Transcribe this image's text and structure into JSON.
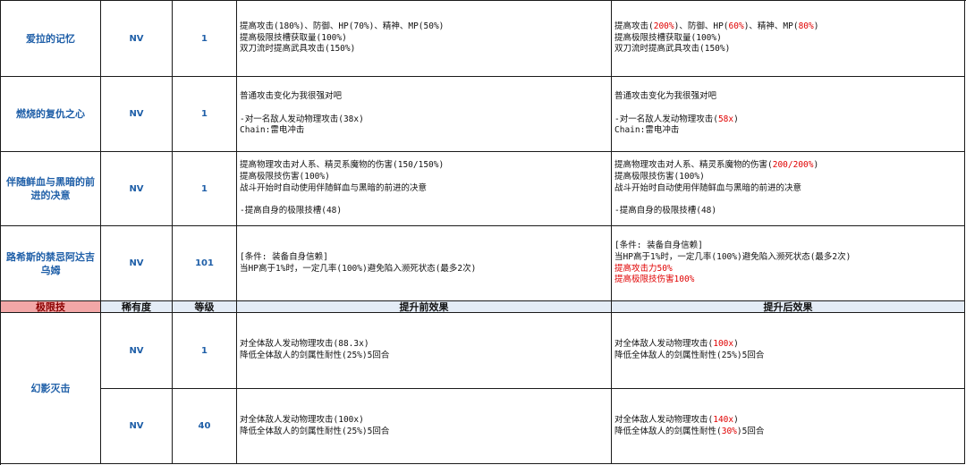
{
  "colors": {
    "name_text": "#1f5fa8",
    "highlight": "#e00000",
    "header_bg": "#e4ecf6",
    "header_first_bg": "#f2a7a7",
    "header_first_text": "#8b0000"
  },
  "header": {
    "name": "极限技",
    "rarity": "稀有度",
    "level": "等级",
    "before": "提升前效果",
    "after": "提升后效果"
  },
  "passives": [
    {
      "name": "爱拉的记忆",
      "rarity": "NV",
      "level": "1",
      "before": [
        [
          {
            "t": "提高攻击(180%)、防御、HP(70%)、精神、MP(50%)"
          }
        ],
        [
          {
            "t": "提高极限技槽获取量(100%)"
          }
        ],
        [
          {
            "t": "双刀流时提高武具攻击(150%)"
          }
        ]
      ],
      "after": [
        [
          {
            "t": "提高攻击("
          },
          {
            "t": "200%",
            "h": true
          },
          {
            "t": ")、防御、HP("
          },
          {
            "t": "60%",
            "h": true
          },
          {
            "t": ")、精神、MP("
          },
          {
            "t": "80%",
            "h": true
          },
          {
            "t": ")"
          }
        ],
        [
          {
            "t": "提高极限技槽获取量(100%)"
          }
        ],
        [
          {
            "t": "双刀流时提高武具攻击(150%)"
          }
        ]
      ]
    },
    {
      "name": "燃烧的复仇之心",
      "rarity": "NV",
      "level": "1",
      "before": [
        [
          {
            "t": "普通攻击变化为我很强对吧"
          }
        ],
        [
          {
            "t": ""
          }
        ],
        [
          {
            "t": "-对一名敌人发动物理攻击(38x)"
          }
        ],
        [
          {
            "t": "Chain:雷电冲击"
          }
        ]
      ],
      "after": [
        [
          {
            "t": "普通攻击变化为我很强对吧"
          }
        ],
        [
          {
            "t": ""
          }
        ],
        [
          {
            "t": "-对一名敌人发动物理攻击("
          },
          {
            "t": "58x",
            "h": true
          },
          {
            "t": ")"
          }
        ],
        [
          {
            "t": "Chain:雷电冲击"
          }
        ]
      ]
    },
    {
      "name": "伴随鲜血与黑暗的前进的决意",
      "rarity": "NV",
      "level": "1",
      "before": [
        [
          {
            "t": "提高物理攻击对人系、精灵系魔物的伤害(150/150%)"
          }
        ],
        [
          {
            "t": "提高极限技伤害(100%)"
          }
        ],
        [
          {
            "t": "战斗开始时自动使用伴随鲜血与黑暗的前进的决意"
          }
        ],
        [
          {
            "t": ""
          }
        ],
        [
          {
            "t": "-提高自身的极限技槽(48)"
          }
        ]
      ],
      "after": [
        [
          {
            "t": "提高物理攻击对人系、精灵系魔物的伤害("
          },
          {
            "t": "200/200%",
            "h": true
          },
          {
            "t": ")"
          }
        ],
        [
          {
            "t": "提高极限技伤害(100%)"
          }
        ],
        [
          {
            "t": "战斗开始时自动使用伴随鲜血与黑暗的前进的决意"
          }
        ],
        [
          {
            "t": ""
          }
        ],
        [
          {
            "t": "-提高自身的极限技槽(48)"
          }
        ]
      ]
    },
    {
      "name": "路希斯的禁忌阿达吉乌姆",
      "rarity": "NV",
      "level": "101",
      "before": [
        [
          {
            "t": "[条件: 装备自身信赖]"
          }
        ],
        [
          {
            "t": "当HP高于1%时，一定几率(100%)避免陷入濒死状态(最多2次)"
          }
        ]
      ],
      "after": [
        [
          {
            "t": "[条件: 装备自身信赖]"
          }
        ],
        [
          {
            "t": "当HP高于1%时，一定几率(100%)避免陷入濒死状态(最多2次)"
          }
        ],
        [
          {
            "t": "提高攻击力50%",
            "h": true
          }
        ],
        [
          {
            "t": "提高极限技伤害100%",
            "h": true
          }
        ]
      ]
    }
  ],
  "limit_burst": {
    "name": "幻影灭击",
    "rows": [
      {
        "rarity": "NV",
        "level": "1",
        "before": [
          [
            {
              "t": "对全体敌人发动物理攻击(88.3x)"
            }
          ],
          [
            {
              "t": "降低全体敌人的剑属性耐性(25%)5回合"
            }
          ]
        ],
        "after": [
          [
            {
              "t": "对全体敌人发动物理攻击("
            },
            {
              "t": "100x",
              "h": true
            },
            {
              "t": ")"
            }
          ],
          [
            {
              "t": "降低全体敌人的剑属性耐性(25%)5回合"
            }
          ]
        ]
      },
      {
        "rarity": "NV",
        "level": "40",
        "before": [
          [
            {
              "t": "对全体敌人发动物理攻击(100x)"
            }
          ],
          [
            {
              "t": "降低全体敌人的剑属性耐性(25%)5回合"
            }
          ]
        ],
        "after": [
          [
            {
              "t": "对全体敌人发动物理攻击("
            },
            {
              "t": "140x",
              "h": true
            },
            {
              "t": ")"
            }
          ],
          [
            {
              "t": "降低全体敌人的剑属性耐性("
            },
            {
              "t": "30%",
              "h": true
            },
            {
              "t": ")5回合"
            }
          ]
        ]
      }
    ]
  }
}
